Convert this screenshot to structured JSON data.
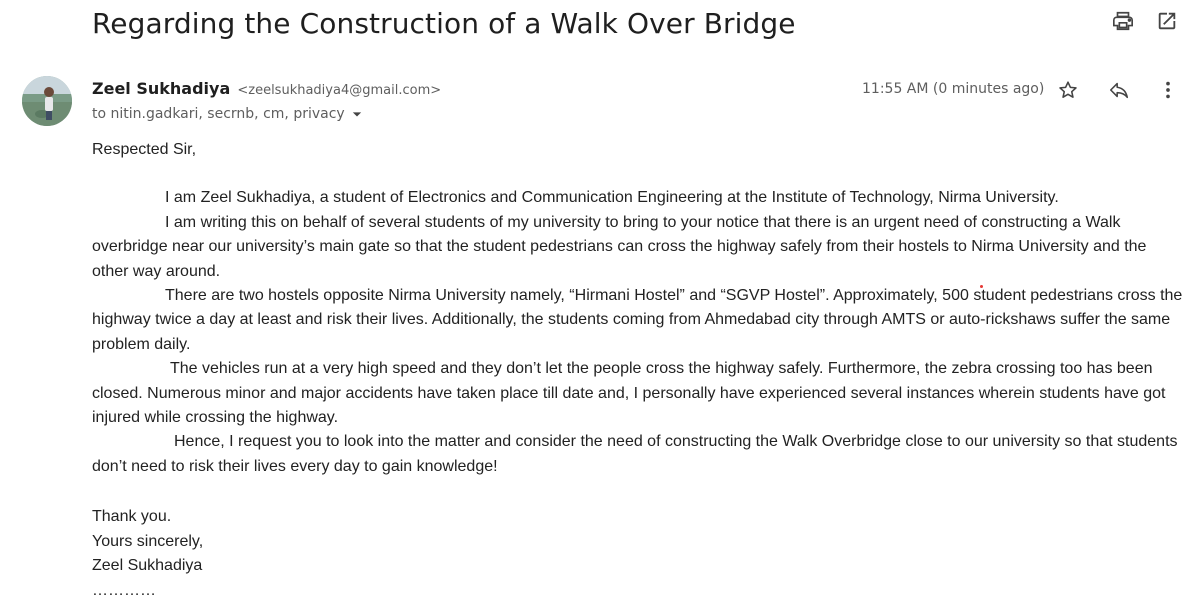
{
  "email": {
    "subject": "Regarding the Construction of a Walk Over Bridge",
    "sender_name": "Zeel Sukhadiya",
    "sender_email": "<zeelsukhadiya4@gmail.com>",
    "recipients": "to nitin.gadkari, secrnb, cm, privacy",
    "time": "11:55 AM (0 minutes ago)"
  },
  "icons": {
    "print": "printer-icon",
    "open_new": "open-in-new-window-icon",
    "star": "star-icon",
    "reply": "reply-icon",
    "more": "more-vertical-icon",
    "dropdown": "caret-down-icon"
  },
  "body": {
    "greeting": "Respected Sir,",
    "p1": "I am Zeel Sukhadiya, a student of Electronics and Communication Engineering at the Institute of Technology, Nirma University.",
    "p2": "I am writing this on behalf of several students of my university to bring to your notice that there is an urgent need of constructing a Walk overbridge near our university’s main gate so that the student pedestrians can cross the highway safely from their hostels to Nirma University and the other way around.",
    "p3": "There are two hostels opposite Nirma University namely, “Hirmani Hostel” and “SGVP Hostel”. Approximately, 500 student pedestrians cross the highway twice a day at least and risk their lives. Additionally, the students coming from Ahmedabad city through AMTS or auto-rickshaws suffer the same problem daily.",
    "p4": "The vehicles run at a very high speed and they don’t let the people cross the highway safely. Furthermore, the zebra crossing too has been closed. Numerous minor and major accidents have taken place till date and, I personally have experienced several instances wherein students have got injured while crossing the highway.",
    "p5": "Hence, I request you to look into the matter and consider the need of constructing the Walk Overbridge close to our university so that students don’t need to risk their lives every day to gain knowledge!",
    "closing1": "Thank you.",
    "closing2": "Yours sincerely,",
    "closing3": "Zeel Sukhadiya",
    "closing4": "…………"
  }
}
